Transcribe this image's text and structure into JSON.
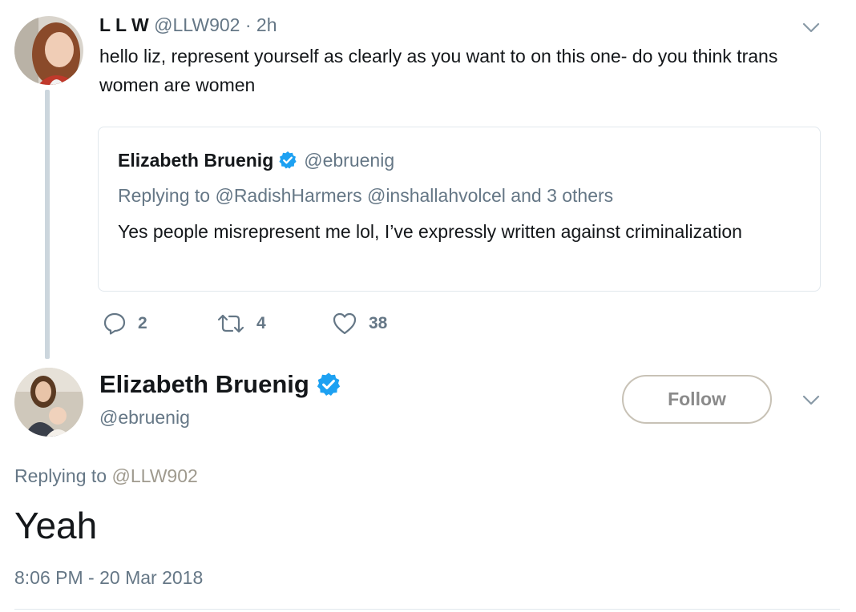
{
  "parent_tweet": {
    "name": "L L W",
    "handle": "@LLW902",
    "time_sep": " · ",
    "time": "2h",
    "text": "hello liz, represent yourself as clearly as you want to on this one- do you think trans women are women",
    "quoted": {
      "name": "Elizabeth Bruenig",
      "handle": "@ebruenig",
      "replying_prefix": "Replying to",
      "replying_to": "@RadishHarmers @inshallahvolcel and 3 others",
      "text": "Yes people misrepresent me lol, I’ve expressly written against criminalization"
    },
    "actions": {
      "replies": "2",
      "retweets": "4",
      "likes": "38"
    }
  },
  "main_tweet": {
    "name": "Elizabeth Bruenig",
    "handle": "@ebruenig",
    "follow_label": "Follow",
    "replying_prefix": "Replying to",
    "replying_to": "@LLW902",
    "text": "Yeah",
    "timestamp": "8:06 PM - 20 Mar 2018"
  },
  "colors": {
    "text": "#14171a",
    "muted": "#657786",
    "verified": "#1da1f2",
    "border": "#e1e8ed"
  }
}
